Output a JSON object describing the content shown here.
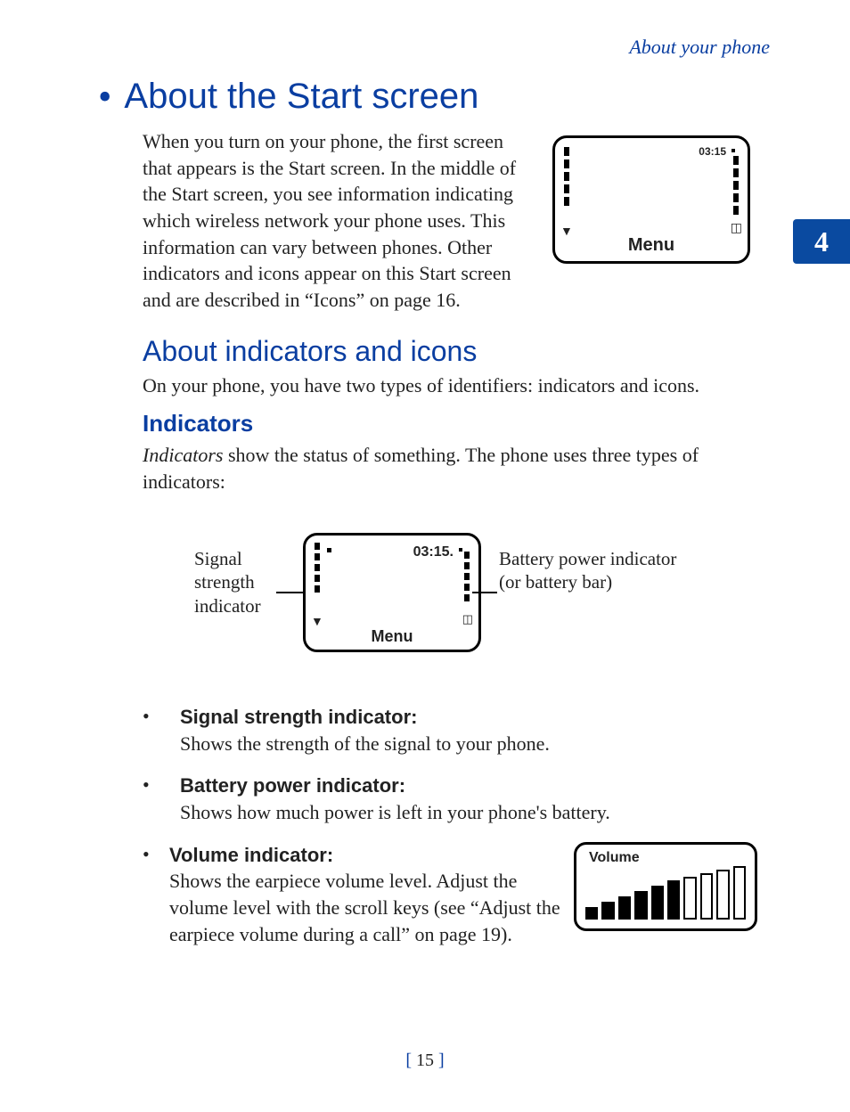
{
  "running_head": "About your phone",
  "chapter_number": "4",
  "h1": "About the Start screen",
  "intro": "When you turn on your phone, the first screen that appears is the Start screen. In the middle of the Start screen, you see information indicating which wireless network your phone uses. This information can vary between phones. Other indicators and icons appear on this Start screen and are described in “Icons” on page 16.",
  "phone_screen": {
    "time": "03:15",
    "menu": "Menu"
  },
  "h2_a": "About indicators and icons",
  "p_after_h2": "On your phone, you have two types of identifiers: indicators and icons.",
  "h3_a": "Indicators",
  "p_after_h3_lead": "Indicators",
  "p_after_h3_rest": " show the status of something. The phone uses three types of indicators:",
  "diagram": {
    "left_label": "Signal strength indicator",
    "right_label": "Battery power indicator (or battery bar)",
    "time": "03:15.",
    "menu": "Menu"
  },
  "bullets": {
    "signal": {
      "label": "Signal strength indicator:",
      "text": "Shows the strength of the signal to your phone."
    },
    "battery": {
      "label": "Battery power indicator:",
      "text": "Shows how much power is left in your phone's battery."
    },
    "volume": {
      "label": "Volume indicator:",
      "text": "Shows the earpiece volume level. Adjust the volume level with the scroll keys (see “Adjust the earpiece volume during a call” on page 19)."
    }
  },
  "volume_box": {
    "title": "Volume",
    "filled_bars": 6,
    "total_bars": 10
  },
  "page_number": "15"
}
